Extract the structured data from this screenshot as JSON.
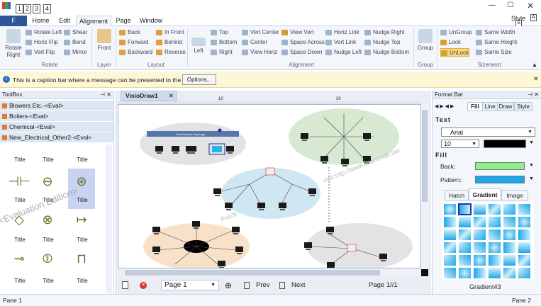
{
  "quick_access": [
    "1",
    "2",
    "3",
    "4"
  ],
  "menu": {
    "file": "F",
    "tabs": [
      "Home",
      "Edit",
      "Alignment",
      "Page",
      "Window"
    ],
    "active": "Alignment",
    "style": "Style",
    "style_key": "S",
    "window_key": "A"
  },
  "ribbon": {
    "rotate": {
      "big": "Rotate Right",
      "items": [
        "Rotate Left",
        "Horiz Flip",
        "Vert Flip",
        "Shear",
        "Bend",
        "Mirror"
      ],
      "label": "Rotate"
    },
    "layer": {
      "big": "Front",
      "label": "Layer"
    },
    "layout": {
      "items": [
        "Back",
        "Forward",
        "Backward",
        "In Front",
        "Behind",
        "Reverse"
      ],
      "label": "Layout"
    },
    "alignment": {
      "big": "Left",
      "items": [
        "Top",
        "Bottom",
        "Right",
        "Vert Center",
        "Center",
        "View Horiz",
        "View Vert",
        "Space Across",
        "Space Down",
        "Horiz Link",
        "Vert Link",
        "Nudge Left",
        "Nudge Right",
        "Nudge Top",
        "Nudge Bottom"
      ],
      "label": "Alignment"
    },
    "group": {
      "big": "Group",
      "label": "Group"
    },
    "sizement": {
      "items": [
        "UnGroup",
        "Lock",
        "UnLock",
        "Same Width",
        "Same Height",
        "Same Size"
      ],
      "label": "Sizement"
    }
  },
  "message": {
    "text": "This is a caption bar where a message can be presented to the user.",
    "button": "Options..."
  },
  "toolbox": {
    "title": "ToolBox",
    "categories": [
      "Blowers Etc.-<Eval>",
      "Boilers-<Eval>",
      "Chemical-<Eval>",
      "New_Electrical_Other2-<Eval>"
    ],
    "titles": [
      "Title",
      "Title",
      "Title",
      "Title",
      "Title",
      "Title",
      "Title",
      "Title",
      "Title",
      "Title",
      "Title",
      "Title",
      "Title",
      "Title",
      "Title"
    ],
    "watermark": "<Evaluation Edition>"
  },
  "document": {
    "tab": "VisioDraw1",
    "ruler": [
      "10",
      "20"
    ],
    "bus_label": "Bus Network Topology",
    "watermark1": "visit:http://www.ucancode.net",
    "watermark2": "Purch"
  },
  "pagenav": {
    "page": "Page  1",
    "prev": "Prev",
    "next": "Next",
    "count": "Page 1//1"
  },
  "format": {
    "title": "Format Bar",
    "tabs": [
      "Fill",
      "Line",
      "Draw",
      "Style"
    ],
    "text_label": "Text",
    "font": "Arial",
    "size": "10",
    "fill_label": "Fill",
    "back_label": "Back:",
    "pattern_label": "Pattern:",
    "back_color": "#8ff08a",
    "pattern_color": "#1ea7e8",
    "subtabs": [
      "Hatch",
      "Gradient",
      "Image"
    ],
    "gradient_name": "Gradient43"
  },
  "status": {
    "left": "Pane 1",
    "right": "Pane 2"
  }
}
